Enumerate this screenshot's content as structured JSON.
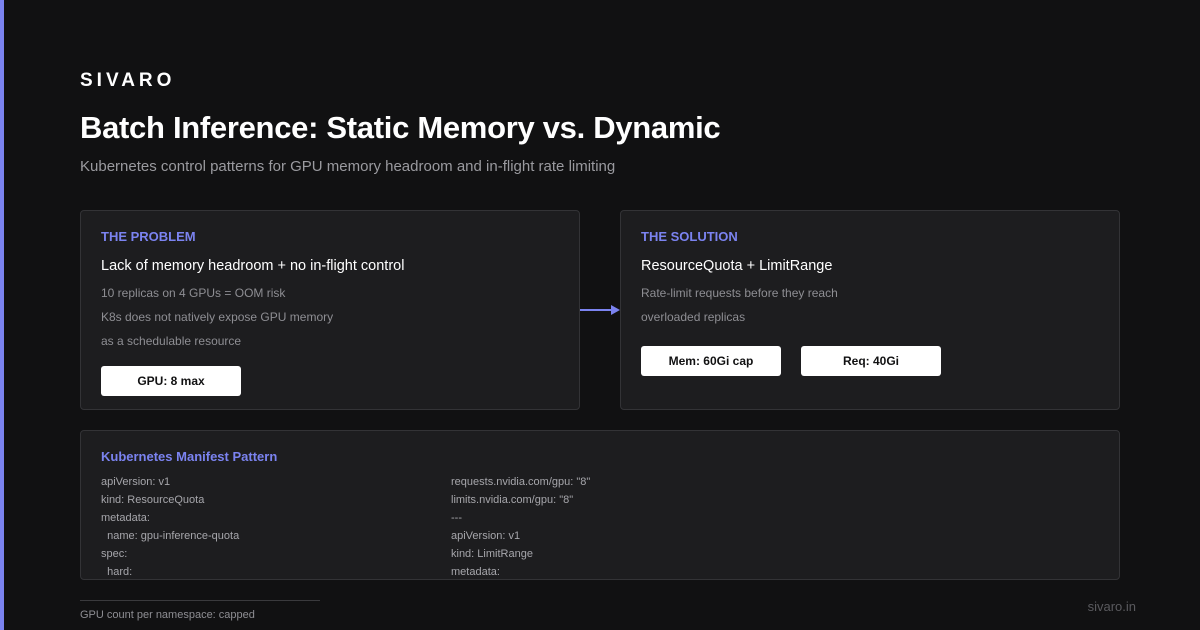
{
  "brand": "SIVARO",
  "title": "Batch Inference: Static Memory vs. Dynamic",
  "subtitle": "Kubernetes control patterns for GPU memory headroom and in-flight rate limiting",
  "problem": {
    "label": "THE PROBLEM",
    "heading": "Lack of memory headroom + no in-flight control",
    "lines": [
      "10 replicas on 4 GPUs = OOM risk",
      "K8s does not natively expose GPU memory",
      "as a schedulable resource"
    ],
    "pills": [
      "GPU: 8 max"
    ]
  },
  "solution": {
    "label": "THE SOLUTION",
    "heading": "ResourceQuota + LimitRange",
    "lines": [
      "Rate-limit requests before they reach",
      "overloaded replicas"
    ],
    "pills": [
      "Mem: 60Gi cap",
      "Req: 40Gi"
    ]
  },
  "manifest": {
    "label": "Kubernetes Manifest Pattern",
    "left_lines": [
      "apiVersion: v1",
      "kind: ResourceQuota",
      "metadata:",
      "  name: gpu-inference-quota",
      "spec:",
      "  hard:"
    ],
    "right_lines": [
      "requests.nvidia.com/gpu: \"8\"",
      "limits.nvidia.com/gpu: \"8\"",
      "---",
      "apiVersion: v1",
      "kind: LimitRange",
      "metadata:"
    ]
  },
  "footer": {
    "note": "GPU count per namespace: capped",
    "url": "sivaro.in"
  },
  "colors": {
    "background": "#111112",
    "accent": "#7b83f0",
    "card": "#1d1d1f"
  },
  "icons": {
    "connector": "arrow-right-icon"
  }
}
